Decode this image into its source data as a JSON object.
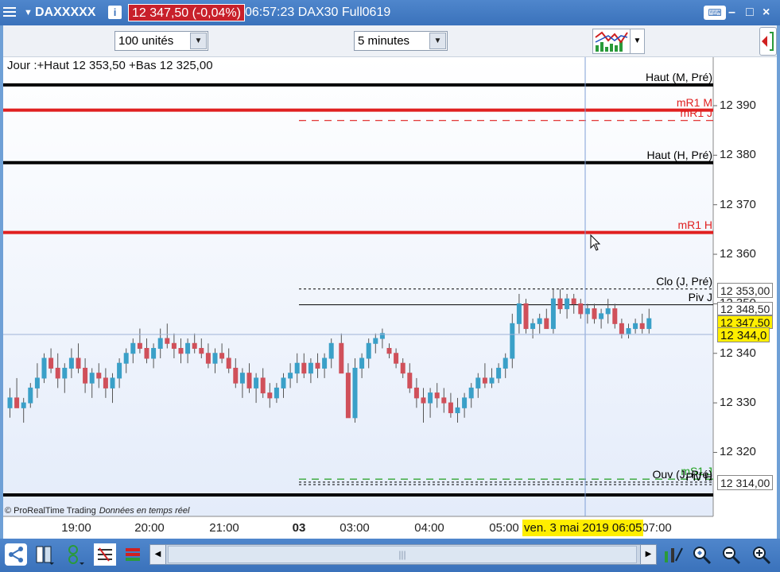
{
  "titlebar": {
    "menu_icon": "hamburger-icon",
    "symbol": "DAXXXXX",
    "info_icon": "info-icon",
    "info_glyph": "i",
    "price": "12 347,50 (-0,04%)",
    "time_text": "06:57:23 DAX30 Full0619",
    "keyboard_icon": "keyboard-icon",
    "min_glyph": "–",
    "max_glyph": "□",
    "close_glyph": "×"
  },
  "toolbar": {
    "units_select": "100 unités",
    "timeframe_select": "5 minutes"
  },
  "chart": {
    "info_line": "Jour :+Haut 12 353,50 +Bas 12 325,00",
    "copyright": "© ProRealTime Trading",
    "realtime": "Données en temps réel",
    "crosshair_date": "ven. 3 mai 2019 06:05",
    "current_price_box": "12 347,50",
    "crosshair_price_box": "12 344,0",
    "level_price_boxes": [
      "12 353,00",
      "12 348,50",
      "12 314,00"
    ]
  },
  "chart_data": {
    "type": "candlestick",
    "ylim": [
      12310.4,
      12396.2
    ],
    "yticks": [
      12320,
      12330,
      12340,
      12350,
      12360,
      12370,
      12380,
      12390
    ],
    "ytick_labels": [
      "12 320",
      "12 330",
      "12 340",
      "12 350",
      "12 360",
      "12 370",
      "12 380",
      "12 390"
    ],
    "xticks": [
      "19:00",
      "20:00",
      "21:00",
      "03",
      "03:00",
      "04:00",
      "05:00",
      "07:00"
    ],
    "levels": [
      {
        "name": "Haut (M, Pré)",
        "value": 12394.2,
        "color": "#000000",
        "style": "solid-thick"
      },
      {
        "name": "mR1 M",
        "value": 12389.1,
        "color": "#e02020",
        "style": "solid-thick"
      },
      {
        "name": "mR1 J",
        "value": 12387.0,
        "color": "#e02020",
        "style": "dashed"
      },
      {
        "name": "Haut (H, Pré)",
        "value": 12378.5,
        "color": "#000000",
        "style": "solid-thick"
      },
      {
        "name": "mR1 H",
        "value": 12364.4,
        "color": "#e02020",
        "style": "solid-thick"
      },
      {
        "name": "Clo (J, Pré)",
        "value": 12353.0,
        "color": "#000000",
        "style": "dotted"
      },
      {
        "name": "Piv J",
        "value": 12349.8,
        "color": "#000000",
        "style": "solid-thin"
      },
      {
        "name": "mS1 J",
        "value": 12314.6,
        "color": "#20a020",
        "style": "dashed"
      },
      {
        "name": "Ouv (J, Pré)",
        "value": 12314.0,
        "color": "#000000",
        "style": "dotted"
      },
      {
        "name": "Piv H",
        "value": 12313.5,
        "color": "#000000",
        "style": "dotted"
      },
      {
        "name": "",
        "value": 12310.4,
        "color": "#000000",
        "style": "solid-thick"
      }
    ],
    "candles": [
      [
        12329,
        12333,
        12327,
        12331
      ],
      [
        12331,
        12335,
        12329,
        12329
      ],
      [
        12329,
        12331,
        12326,
        12330
      ],
      [
        12330,
        12334,
        12329,
        12333
      ],
      [
        12333,
        12338,
        12331,
        12335
      ],
      [
        12335,
        12340,
        12334,
        12339
      ],
      [
        12339,
        12341,
        12336,
        12337
      ],
      [
        12337,
        12340,
        12333,
        12335
      ],
      [
        12335,
        12338,
        12332,
        12337
      ],
      [
        12337,
        12341,
        12335,
        12339
      ],
      [
        12339,
        12342,
        12336,
        12337
      ],
      [
        12337,
        12339,
        12332,
        12334
      ],
      [
        12334,
        12337,
        12331,
        12336
      ],
      [
        12336,
        12338,
        12333,
        12335
      ],
      [
        12335,
        12337,
        12331,
        12333
      ],
      [
        12333,
        12336,
        12330,
        12335
      ],
      [
        12335,
        12339,
        12333,
        12338
      ],
      [
        12338,
        12341,
        12336,
        12340
      ],
      [
        12340,
        12343,
        12338,
        12342
      ],
      [
        12342,
        12345,
        12340,
        12341
      ],
      [
        12341,
        12343,
        12338,
        12339
      ],
      [
        12339,
        12342,
        12337,
        12341
      ],
      [
        12341,
        12345,
        12339,
        12343
      ],
      [
        12343,
        12346,
        12341,
        12342
      ],
      [
        12342,
        12344,
        12339,
        12341
      ],
      [
        12341,
        12343,
        12338,
        12340
      ],
      [
        12340,
        12343,
        12338,
        12342
      ],
      [
        12342,
        12344,
        12340,
        12341
      ],
      [
        12341,
        12343,
        12339,
        12340
      ],
      [
        12340,
        12342,
        12337,
        12338
      ],
      [
        12338,
        12341,
        12336,
        12340
      ],
      [
        12340,
        12342,
        12338,
        12339
      ],
      [
        12339,
        12341,
        12336,
        12337
      ],
      [
        12337,
        12339,
        12333,
        12334
      ],
      [
        12334,
        12337,
        12331,
        12336
      ],
      [
        12336,
        12338,
        12332,
        12333
      ],
      [
        12333,
        12336,
        12330,
        12335
      ],
      [
        12335,
        12337,
        12331,
        12332
      ],
      [
        12332,
        12334,
        12329,
        12331
      ],
      [
        12331,
        12334,
        12330,
        12333
      ],
      [
        12333,
        12336,
        12331,
        12335
      ],
      [
        12335,
        12338,
        12333,
        12336
      ],
      [
        12336,
        12340,
        12334,
        12338
      ],
      [
        12338,
        12340,
        12335,
        12336
      ],
      [
        12336,
        12339,
        12334,
        12338
      ],
      [
        12338,
        12340,
        12335,
        12337
      ],
      [
        12337,
        12340,
        12335,
        12339
      ],
      [
        12339,
        12343,
        12337,
        12342
      ],
      [
        12342,
        12344,
        12337,
        12336
      ],
      [
        12336,
        12338,
        12331,
        12327
      ],
      [
        12327,
        12339,
        12326,
        12337
      ],
      [
        12337,
        12340,
        12335,
        12339
      ],
      [
        12339,
        12343,
        12337,
        12342
      ],
      [
        12342,
        12344,
        12340,
        12343
      ],
      [
        12343,
        12345,
        12341,
        12344
      ],
      [
        12341,
        12342,
        12339,
        12340
      ],
      [
        12340,
        12341,
        12337,
        12338
      ],
      [
        12338,
        12339,
        12335,
        12336
      ],
      [
        12336,
        12338,
        12332,
        12333
      ],
      [
        12333,
        12335,
        12329,
        12331
      ],
      [
        12331,
        12333,
        12326,
        12330
      ],
      [
        12330,
        12333,
        12327,
        12332
      ],
      [
        12332,
        12334,
        12329,
        12331
      ],
      [
        12331,
        12333,
        12328,
        12330
      ],
      [
        12330,
        12332,
        12327,
        12328
      ],
      [
        12328,
        12331,
        12326,
        12329
      ],
      [
        12329,
        12332,
        12327,
        12331
      ],
      [
        12331,
        12334,
        12329,
        12333
      ],
      [
        12333,
        12336,
        12331,
        12335
      ],
      [
        12335,
        12338,
        12333,
        12334
      ],
      [
        12334,
        12337,
        12333,
        12335
      ],
      [
        12335,
        12338,
        12334,
        12337
      ],
      [
        12337,
        12340,
        12335,
        12339
      ],
      [
        12339,
        12348,
        12337,
        12346
      ],
      [
        12346,
        12352,
        12344,
        12350
      ],
      [
        12350,
        12351,
        12344,
        12345
      ],
      [
        12345,
        12347,
        12343,
        12346
      ],
      [
        12346,
        12348,
        12344,
        12347
      ],
      [
        12347,
        12349,
        12345,
        12345
      ],
      [
        12345,
        12353,
        12344,
        12351
      ],
      [
        12351,
        12353,
        12348,
        12349
      ],
      [
        12349,
        12352,
        12347,
        12351
      ],
      [
        12351,
        12352,
        12348,
        12350
      ],
      [
        12350,
        12351,
        12347,
        12348
      ],
      [
        12348,
        12350,
        12346,
        12349
      ],
      [
        12349,
        12350,
        12346,
        12347
      ],
      [
        12347,
        12349,
        12345,
        12348
      ],
      [
        12348,
        12351,
        12346,
        12349
      ],
      [
        12349,
        12350,
        12345,
        12346
      ],
      [
        12346,
        12347,
        12343,
        12344
      ],
      [
        12344,
        12346,
        12343,
        12345
      ],
      [
        12345,
        12347,
        12344,
        12346
      ],
      [
        12346,
        12348,
        12344,
        12345
      ],
      [
        12345,
        12349,
        12344,
        12347
      ]
    ]
  },
  "bottombar": {
    "share_icon": "share-icon",
    "layout_icon": "layout-icon",
    "indicator_icon": "indicator-icon",
    "list_icon": "list-icon",
    "bars_icon": "bars-icon",
    "scroll_thumb_glyph": "|||",
    "drawing_icon": "drawing-icon",
    "zoom_fit_icon": "zoom-fit-icon",
    "zoom_out_icon": "zoom-out-icon",
    "zoom_in_icon": "zoom-in-icon"
  }
}
